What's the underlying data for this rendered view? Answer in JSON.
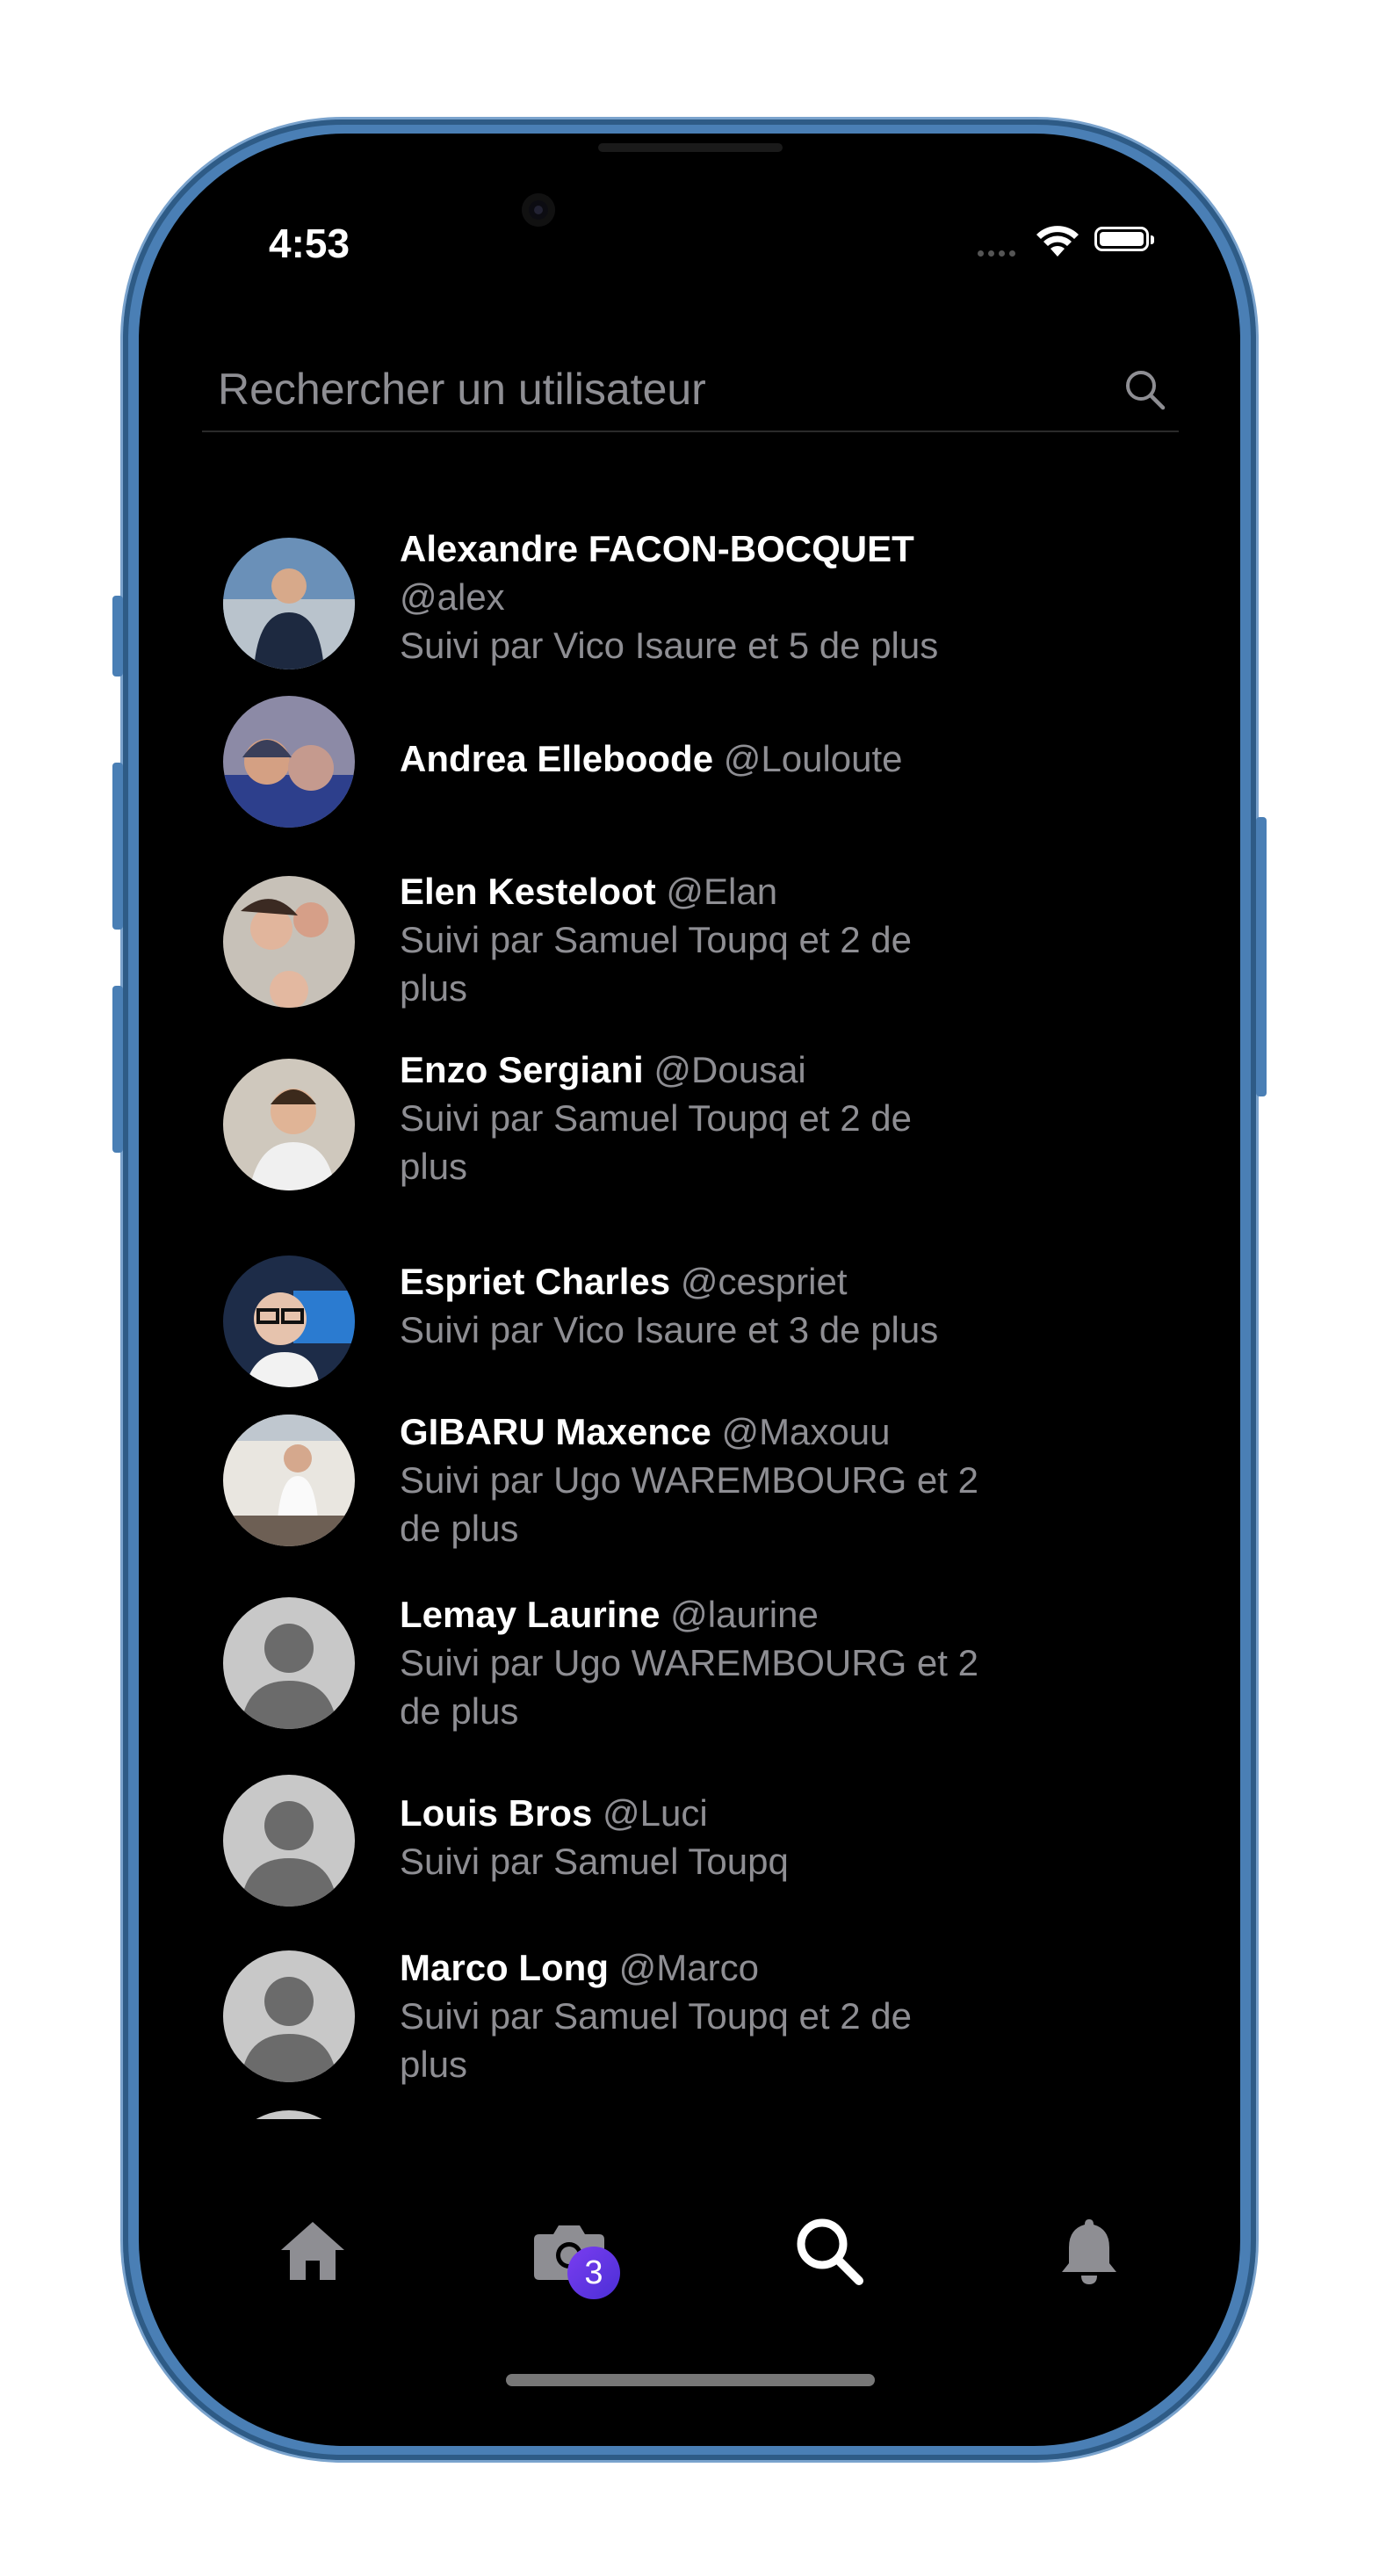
{
  "status_bar": {
    "time": "4:53"
  },
  "search": {
    "placeholder": "Rechercher un utilisateur",
    "value": ""
  },
  "users": [
    {
      "name": "Alexandre FACON-BOCQUET",
      "handle": "@alex",
      "followed_by": "Suivi par Vico Isaure et 5 de plus",
      "avatar": "photo"
    },
    {
      "name": "Andrea Elleboode",
      "handle": "@Louloute",
      "followed_by": "",
      "avatar": "photo"
    },
    {
      "name": "Elen Kesteloot",
      "handle": "@Elan",
      "followed_by": "Suivi par Samuel Toupq et 2 de plus",
      "avatar": "photo"
    },
    {
      "name": "Enzo Sergiani",
      "handle": "@Dousai",
      "followed_by": "Suivi par Samuel Toupq et 2 de plus",
      "avatar": "photo"
    },
    {
      "name": "Espriet Charles",
      "handle": "@cespriet",
      "followed_by": "Suivi par Vico Isaure et 3 de plus",
      "avatar": "photo"
    },
    {
      "name": "GIBARU Maxence",
      "handle": "@Maxouu",
      "followed_by": "Suivi par Ugo WAREMBOURG  et 2 de plus",
      "avatar": "photo"
    },
    {
      "name": "Lemay Laurine",
      "handle": "@laurine",
      "followed_by": "Suivi par Ugo WAREMBOURG  et 2 de plus",
      "avatar": "default"
    },
    {
      "name": "Louis Bros",
      "handle": "@Luci",
      "followed_by": "Suivi par Samuel Toupq",
      "avatar": "default"
    },
    {
      "name": "Marco Long",
      "handle": "@Marco",
      "followed_by": "Suivi par Samuel Toupq et 2 de plus",
      "avatar": "default"
    }
  ],
  "tabbar": {
    "tabs": [
      {
        "icon": "home-icon",
        "active": false
      },
      {
        "icon": "camera-icon",
        "active": false,
        "badge": "3"
      },
      {
        "icon": "search-icon",
        "active": true
      },
      {
        "icon": "bell-icon",
        "active": false
      }
    ],
    "camera_badge": "3"
  },
  "colors": {
    "background": "#000000",
    "primary_text": "#ffffff",
    "secondary_text": "#8e8e93",
    "badge": "#5b34e6",
    "inactive_icon": "#8e8e93"
  }
}
